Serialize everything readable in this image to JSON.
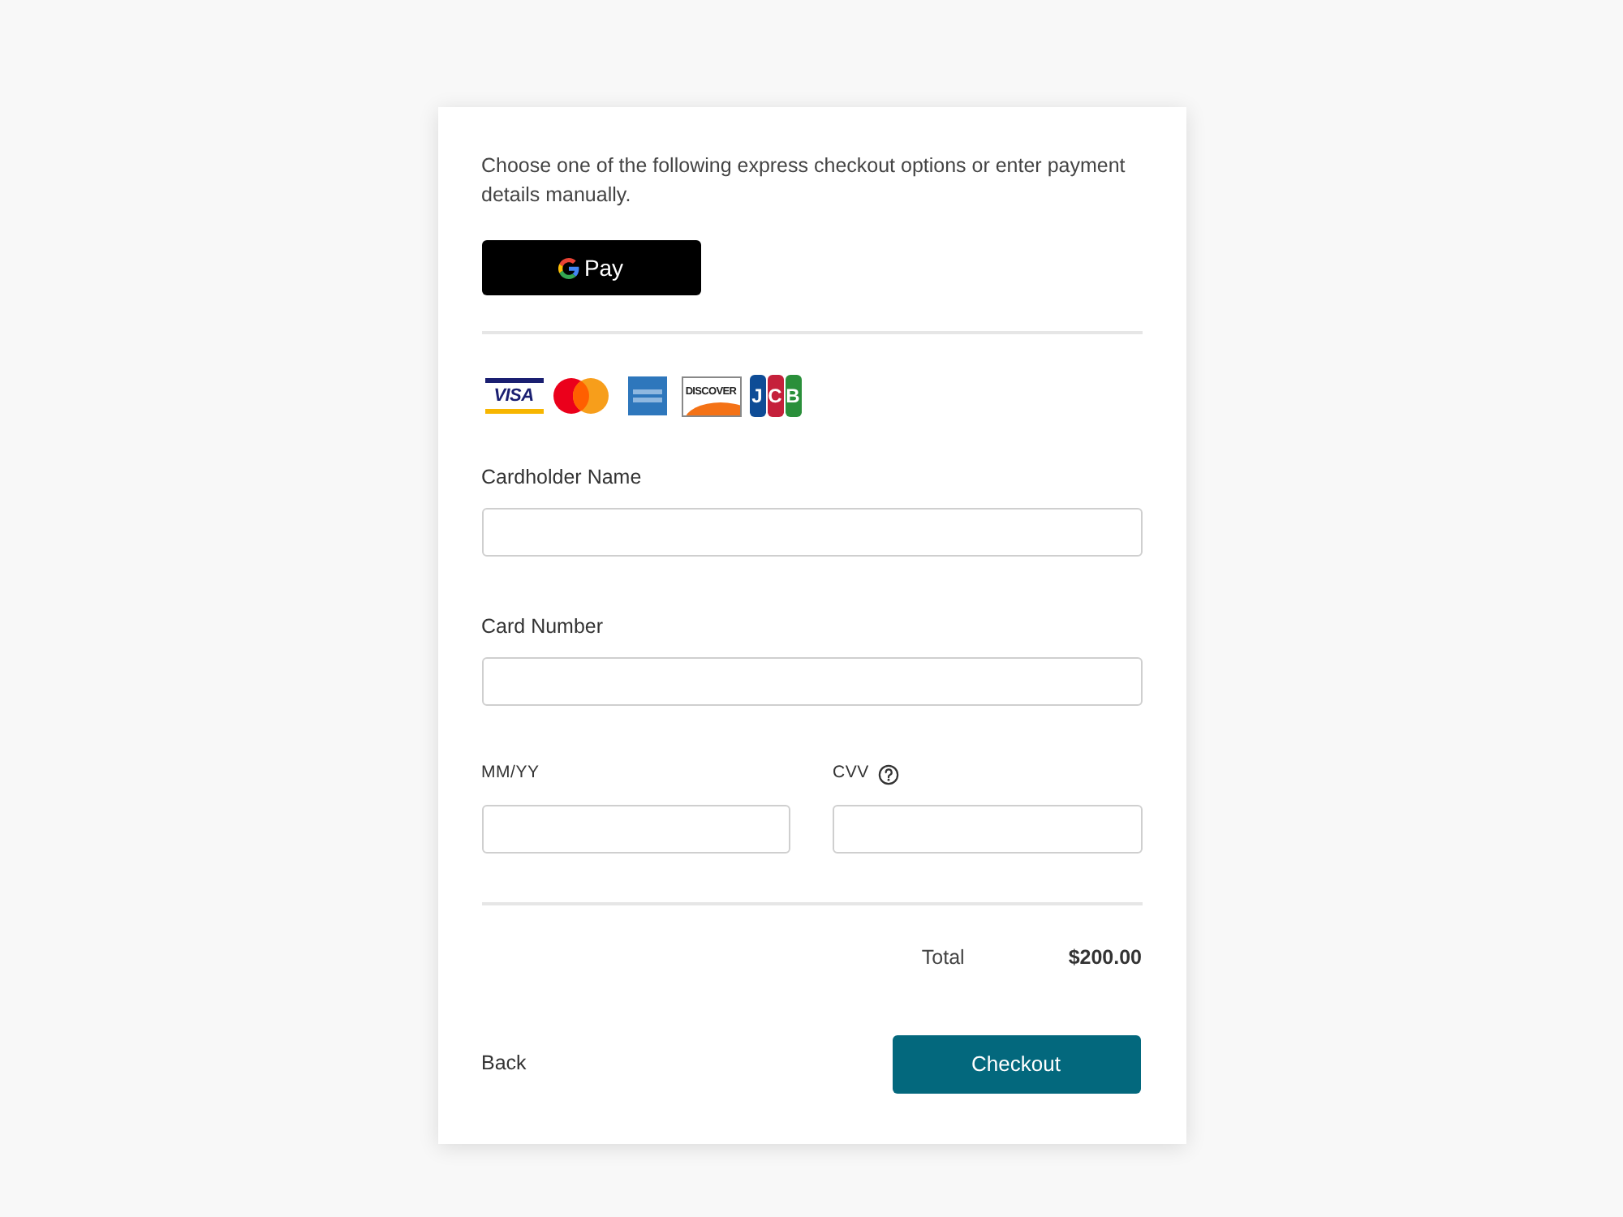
{
  "intro": "Choose one of the following express checkout options or enter payment details manually.",
  "express_button": {
    "label": "Pay"
  },
  "card_brands": [
    {
      "kind": "visa",
      "label": "VISA"
    },
    {
      "kind": "mastercard"
    },
    {
      "kind": "amex"
    },
    {
      "kind": "discover",
      "label": "DISCOVER"
    },
    {
      "kind": "jcb",
      "label": "JCB"
    }
  ],
  "fields": [
    {
      "label": "Cardholder Name"
    },
    {
      "label": "Card Number"
    }
  ],
  "short_fields": [
    {
      "label": "MM/YY",
      "help": false
    },
    {
      "label": "CVV",
      "help": true
    }
  ],
  "total": {
    "label": "Total",
    "value": "$200.00"
  },
  "actions": {
    "back": "Back",
    "checkout": "Checkout"
  }
}
